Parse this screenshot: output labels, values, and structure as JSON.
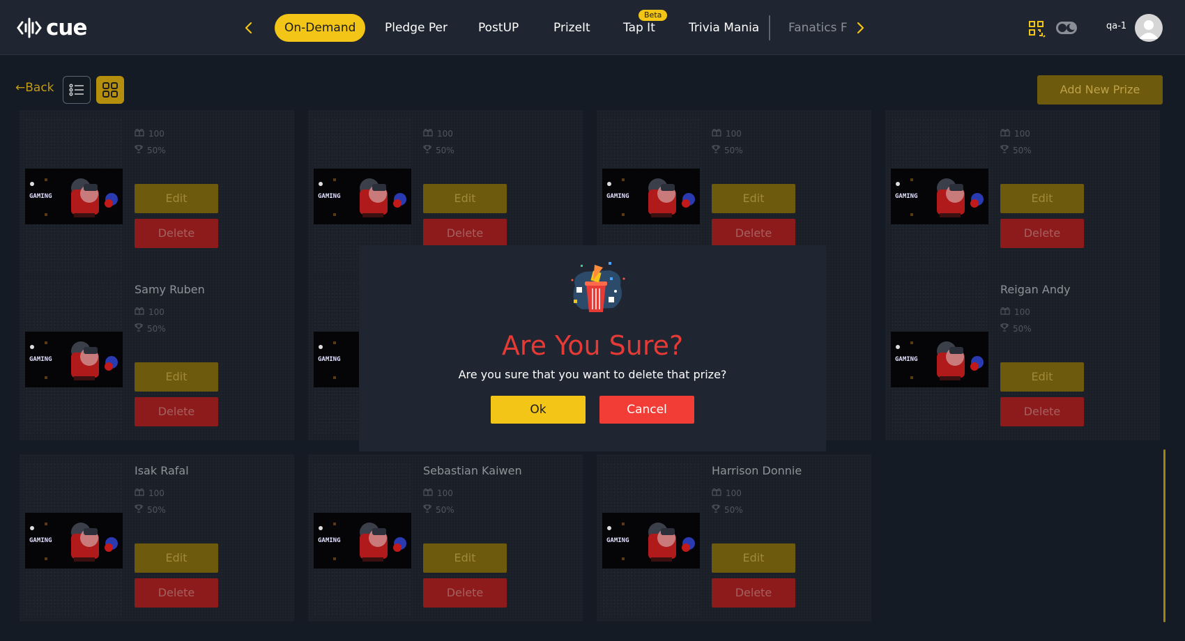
{
  "header": {
    "logo_text": "cue",
    "tabs": [
      {
        "label": "On-Demand"
      },
      {
        "label": "Pledge Per"
      },
      {
        "label": "PostUP"
      },
      {
        "label": "PrizeIt"
      },
      {
        "label": "Tap It",
        "badge": "Beta"
      },
      {
        "label": "Trivia Mania"
      },
      {
        "label": "Fanatics F"
      }
    ],
    "user_name": "qa-1"
  },
  "toolbar": {
    "back_label": "←Back",
    "add_button_label": "Add New Prize"
  },
  "cards": [
    {
      "name": "",
      "points": "100",
      "percent": "50%",
      "edit_label": "Edit",
      "delete_label": "Delete"
    },
    {
      "name": "",
      "points": "100",
      "percent": "50%",
      "edit_label": "Edit",
      "delete_label": "Delete"
    },
    {
      "name": "",
      "points": "100",
      "percent": "50%",
      "edit_label": "Edit",
      "delete_label": "Delete"
    },
    {
      "name": "",
      "points": "100",
      "percent": "50%",
      "edit_label": "Edit",
      "delete_label": "Delete"
    },
    {
      "name": "Samy Ruben",
      "points": "100",
      "percent": "50%",
      "edit_label": "Edit",
      "delete_label": "Delete"
    },
    {
      "name": "",
      "points": "",
      "percent": "",
      "edit_label": "",
      "delete_label": ""
    },
    {
      "name": "",
      "points": "",
      "percent": "",
      "edit_label": "",
      "delete_label": ""
    },
    {
      "name": "Reigan Andy",
      "points": "100",
      "percent": "50%",
      "edit_label": "Edit",
      "delete_label": "Delete"
    },
    {
      "name": "Isak Rafal",
      "points": "100",
      "percent": "50%",
      "edit_label": "Edit",
      "delete_label": "Delete"
    },
    {
      "name": "Sebastian Kaiwen",
      "points": "100",
      "percent": "50%",
      "edit_label": "Edit",
      "delete_label": "Delete"
    },
    {
      "name": "Harrison Donnie",
      "points": "100",
      "percent": "50%",
      "edit_label": "Edit",
      "delete_label": "Delete"
    }
  ],
  "thumbnail_text": "GAMING",
  "modal": {
    "title": "Are You Sure?",
    "message": "Are you sure that you want to delete that prize?",
    "ok_label": "Ok",
    "cancel_label": "Cancel"
  },
  "colors": {
    "accent": "#f2c516",
    "danger": "#f23c36",
    "background": "#151b24",
    "header": "#1f2631"
  }
}
